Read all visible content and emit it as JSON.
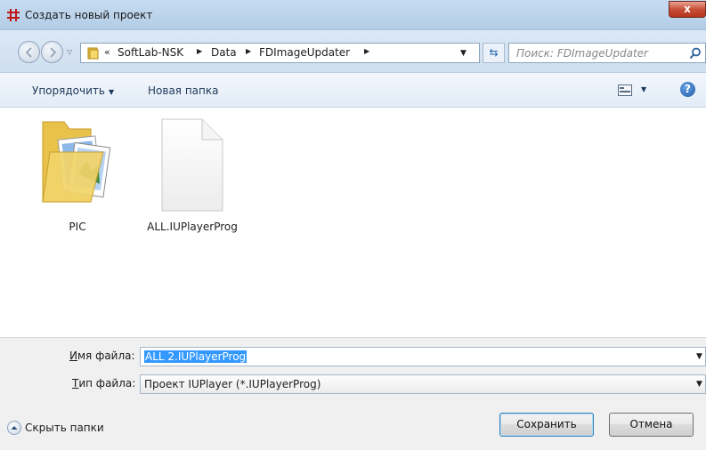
{
  "window": {
    "title": "Создать новый проект",
    "close_label": "x"
  },
  "address": {
    "overflow": "«",
    "breadcrumbs": [
      "SoftLab-NSK",
      "Data",
      "FDImageUpdater"
    ],
    "search_placeholder": "Поиск: FDImageUpdater"
  },
  "toolbar": {
    "organize_label": "Упорядочить",
    "new_folder_label": "Новая папка",
    "help_label": "?"
  },
  "files": [
    {
      "name": "PIC",
      "icon": "folder-icon"
    },
    {
      "name": "ALL.IUPlayerProg",
      "icon": "blank-file-icon"
    }
  ],
  "bottom": {
    "filename_label_prefix": "И",
    "filename_label_rest": "мя файла:",
    "filename_value": "ALL 2.IUPlayerProg",
    "filetype_label_prefix": "Т",
    "filetype_label_rest": "ип файла:",
    "filetype_value": "Проект IUPlayer (*.IUPlayerProg)",
    "hide_folders_label": "Скрыть папки",
    "save_label": "Сохранить",
    "cancel_label": "Отмена"
  },
  "colors": {
    "selection": "#3399ff",
    "title_bar": "#c6dbf0",
    "close_button": "#c74f37"
  }
}
